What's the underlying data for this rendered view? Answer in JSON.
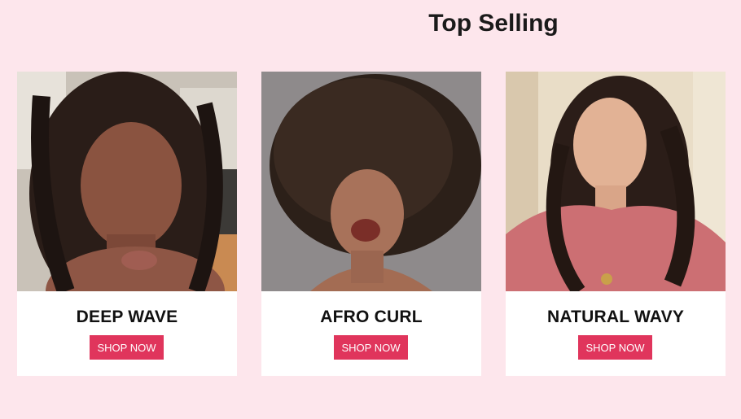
{
  "section": {
    "title": "Top Selling"
  },
  "products": [
    {
      "name": "DEEP WAVE",
      "button_label": "SHOP NOW"
    },
    {
      "name": "AFRO CURL",
      "button_label": "SHOP NOW"
    },
    {
      "name": "NATURAL WAVY",
      "button_label": "SHOP NOW"
    }
  ],
  "colors": {
    "page_background": "#fde6ec",
    "card_background": "#ffffff",
    "button_background": "#e0355c",
    "button_text": "#ffffff",
    "title_text": "#1a1a1a"
  }
}
